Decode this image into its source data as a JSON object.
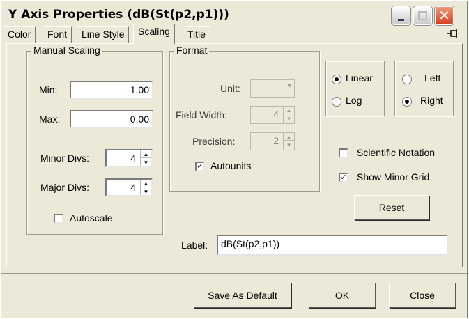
{
  "window": {
    "title": "Y Axis Properties (dB(St(p2,p1)))",
    "close_glyph": "✕"
  },
  "tabs": [
    {
      "label": "Color"
    },
    {
      "label": "Font"
    },
    {
      "label": "Line Style"
    },
    {
      "label": "Scaling",
      "active": true
    },
    {
      "label": "Title"
    }
  ],
  "pin_icon": "pin-icon",
  "manual_scaling": {
    "legend": "Manual Scaling",
    "min_label": "Min:",
    "min_value": "-1.00",
    "max_label": "Max:",
    "max_value": "0.00",
    "minor_divs_label": "Minor Divs:",
    "minor_divs_value": "4",
    "major_divs_label": "Major Divs:",
    "major_divs_value": "4",
    "autoscale_label": "Autoscale",
    "autoscale_checked": false
  },
  "format": {
    "legend": "Format",
    "unit_label": "Unit:",
    "unit_value": "",
    "field_width_label": "Field Width:",
    "field_width_value": "4",
    "precision_label": "Precision:",
    "precision_value": "2",
    "autounits_label": "Autounits",
    "autounits_checked": true
  },
  "scale_type": {
    "linear_label": "Linear",
    "log_label": "Log",
    "selected": "Linear"
  },
  "side": {
    "left_label": "Left",
    "right_label": "Right",
    "selected": "Right"
  },
  "options": {
    "scientific_label": "Scientific Notation",
    "scientific_checked": false,
    "minor_grid_label": "Show Minor Grid",
    "minor_grid_checked": true
  },
  "reset_label": "Reset",
  "axis_label": {
    "label": "Label:",
    "value": "dB(St(p2,p1))"
  },
  "footer": {
    "save_default_label": "Save As Default",
    "ok_label": "OK",
    "close_label": "Close"
  },
  "glyphs": {
    "check": "✓",
    "spin_up": "▲",
    "spin_down": "▼",
    "dropdown": "▼",
    "pin": "⊣◻"
  },
  "colors": {
    "dialog_bg": "#ece9d8",
    "close_button": "#d3411b"
  }
}
